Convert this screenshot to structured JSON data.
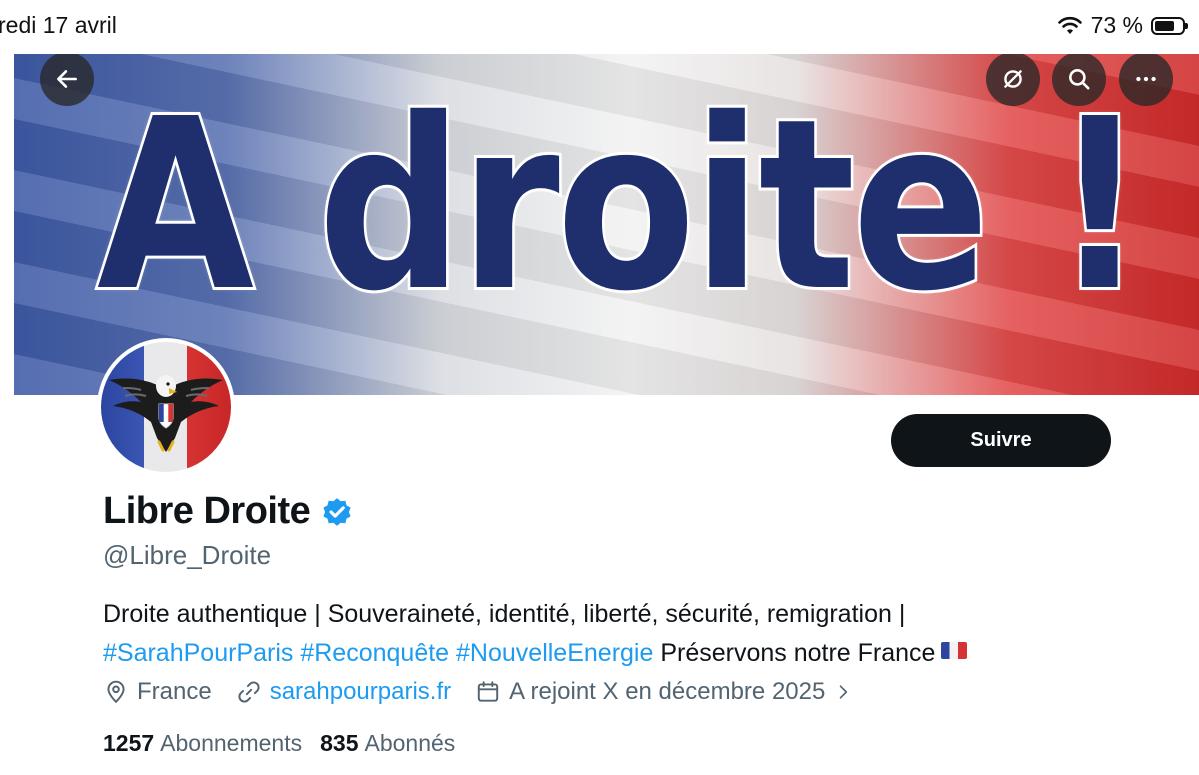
{
  "status_bar": {
    "date": "redi 17 avril",
    "battery_text": "73 %",
    "battery_level": 0.73,
    "wifi_icon": "wifi-icon"
  },
  "banner": {
    "text": "A droite !",
    "buttons": {
      "back": "back-arrow-icon",
      "grok": "grok-icon",
      "search": "search-icon",
      "more": "more-icon"
    }
  },
  "profile": {
    "follow_label": "Suivre",
    "display_name": "Libre Droite",
    "handle": "@Libre_Droite",
    "bio_line1": "Droite authentique | Souveraineté, identité, liberté, sécurité, remigration |",
    "hashtags": [
      "#SarahPourParis",
      "#Reconquête",
      "#NouvelleEnergie"
    ],
    "bio_tail": "Préservons notre France",
    "location": "France",
    "website": "sarahpourparis.fr",
    "joined": "A rejoint X en décembre 2025",
    "following_count": "1257",
    "following_label": "Abonnements",
    "followers_count": "835",
    "followers_label": "Abonnés"
  },
  "colors": {
    "accent": "#1d9bf0",
    "text": "#0f1419",
    "muted": "#536471",
    "verified": "#1d9bf0",
    "banner_text": "#1f2f6e"
  }
}
